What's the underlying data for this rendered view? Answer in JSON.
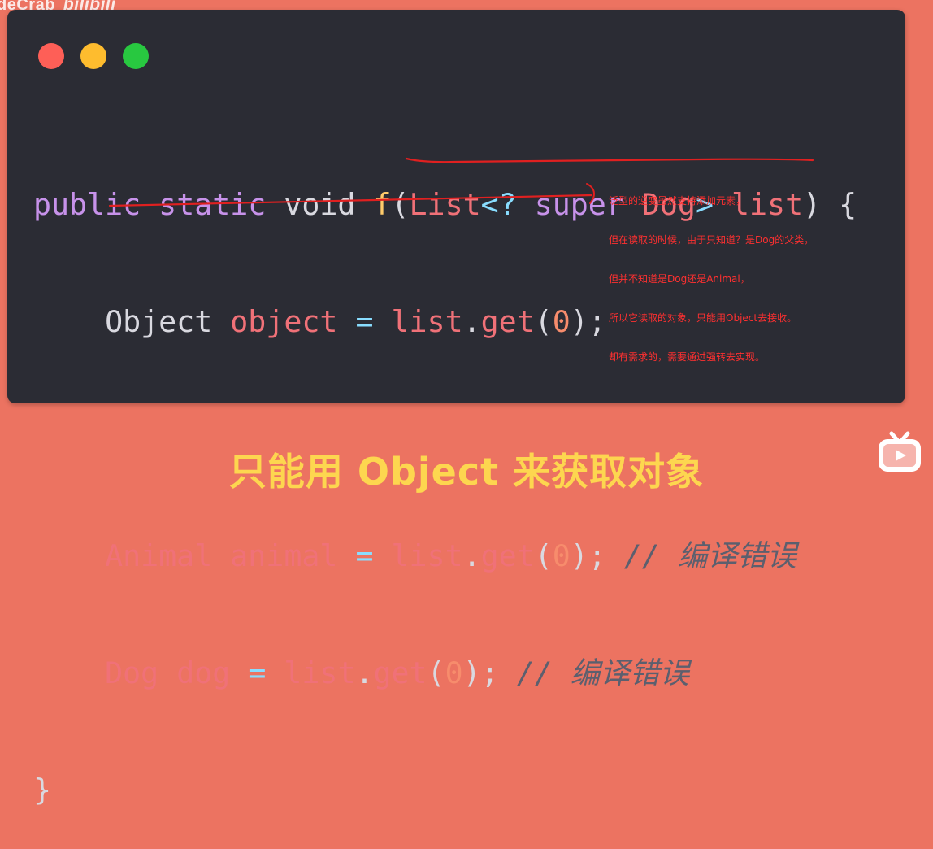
{
  "watermark": {
    "text": "deCrab",
    "brand": "bilibili"
  },
  "window_controls": [
    "close",
    "minimize",
    "maximize"
  ],
  "code": {
    "line1": {
      "a": "public",
      "b": "static",
      "c": "void",
      "d": "f",
      "e": "(",
      "f": "List",
      "g": "<",
      "h": "?",
      "i": "super",
      "j": "Dog",
      "k": ">",
      "l": "list",
      "m": ")",
      "n": "{"
    },
    "line2": {
      "a": "Object",
      "b": "object",
      "c": "=",
      "d": "list",
      "e": ".",
      "f": "get",
      "g": "(",
      "h": "0",
      "i": ");"
    },
    "line3": {
      "a": "Animal",
      "b": "animal",
      "c": "=",
      "d": "list",
      "e": ".",
      "f": "get",
      "g": "(",
      "h": "0",
      "i": ");",
      "comment": "// 编译错误"
    },
    "line4": {
      "a": "Dog",
      "b": "dog",
      "c": "=",
      "d": "list",
      "e": ".",
      "f": "get",
      "g": "(",
      "h": "0",
      "i": ");",
      "comment": "// 编译错误"
    },
    "line5": {
      "a": "}"
    }
  },
  "annotation": {
    "lines": [
      "泛型的逆变虽然支持添加元素，",
      "但在读取的时候，由于只知道？是Dog的父类，",
      "但并不知道是Dog还是Animal，",
      "所以它读取的对象，只能用Object去接收。",
      "却有需求的，需要通过强转去实现。"
    ]
  },
  "subtitle": "只能用 Object 来获取对象",
  "icons": {
    "brand": "bilibili-tv-icon"
  },
  "colors": {
    "background": "#ec7361",
    "editor_bg": "#2b2c34",
    "subtitle": "#fdd64f",
    "annotation": "#ff3030",
    "keyword": "#c792ea",
    "type": "#f07178",
    "function": "#ffcb6b",
    "comment": "#5c5f6e"
  }
}
